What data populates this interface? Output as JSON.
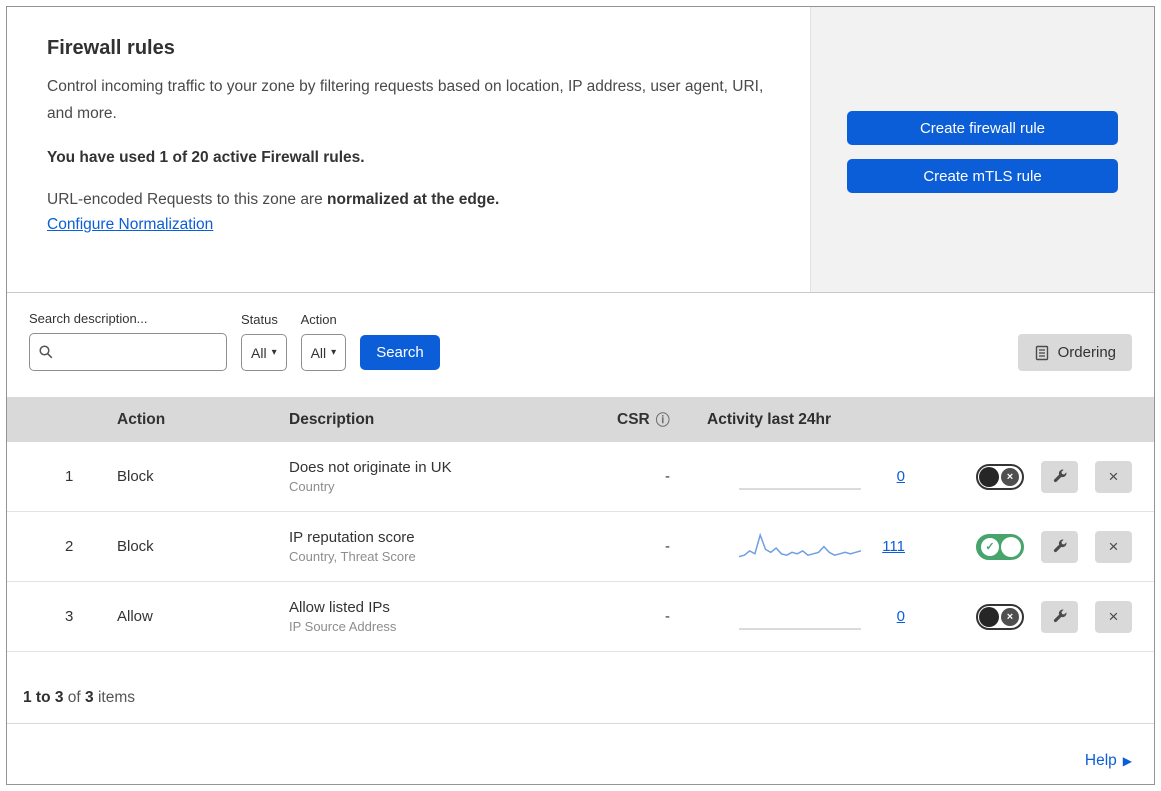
{
  "colors": {
    "accent": "#0b5ed7",
    "toggle_on": "#46a46c",
    "spark_line": "#6f9fe0",
    "flat_line": "#cfcfcf"
  },
  "icons": {
    "caret": "▾",
    "info": "ⓘ",
    "toggle_on": "✓",
    "toggle_off": "×",
    "close": "×",
    "help_arrow": "▶"
  },
  "header": {
    "title": "Firewall rules",
    "description": "Control incoming traffic to your zone by filtering requests based on location, IP address, user agent, URI, and more.",
    "usage_bold": "You have used 1 of 20 active Firewall rules.",
    "normalization_prefix": "URL-encoded Requests to this zone are ",
    "normalization_bold": "normalized at the edge.",
    "normalization_link": "Configure Normalization",
    "buttons": [
      {
        "label": "Create firewall rule"
      },
      {
        "label": "Create mTLS rule"
      }
    ]
  },
  "filters": {
    "search_label": "Search description...",
    "status_label": "Status",
    "status_value": "All",
    "action_label": "Action",
    "action_value": "All",
    "search_button": "Search",
    "ordering_button": "Ordering"
  },
  "table": {
    "columns": {
      "action": "Action",
      "description": "Description",
      "csr": "CSR",
      "activity": "Activity last 24hr"
    },
    "rows": [
      {
        "priority": "1",
        "action": "Block",
        "description": "Does not originate in UK",
        "fields": "Country",
        "csr": "-",
        "activity_count": "0",
        "enabled": false,
        "sparkline": []
      },
      {
        "priority": "2",
        "action": "Block",
        "description": "IP reputation score",
        "fields": "Country, Threat Score",
        "csr": "-",
        "activity_count": "111",
        "enabled": true,
        "sparkline": [
          3,
          4,
          7,
          5,
          18,
          8,
          6,
          9,
          5,
          4,
          6,
          5,
          7,
          4,
          5,
          6,
          10,
          6,
          4,
          5,
          6,
          5,
          6,
          7
        ]
      },
      {
        "priority": "3",
        "action": "Allow",
        "description": "Allow listed IPs",
        "fields": "IP Source Address",
        "csr": "-",
        "activity_count": "0",
        "enabled": false,
        "sparkline": []
      }
    ]
  },
  "footer": {
    "range": "1 to 3",
    "of_text": "of",
    "total": "3",
    "items_text": "items",
    "help": "Help"
  }
}
